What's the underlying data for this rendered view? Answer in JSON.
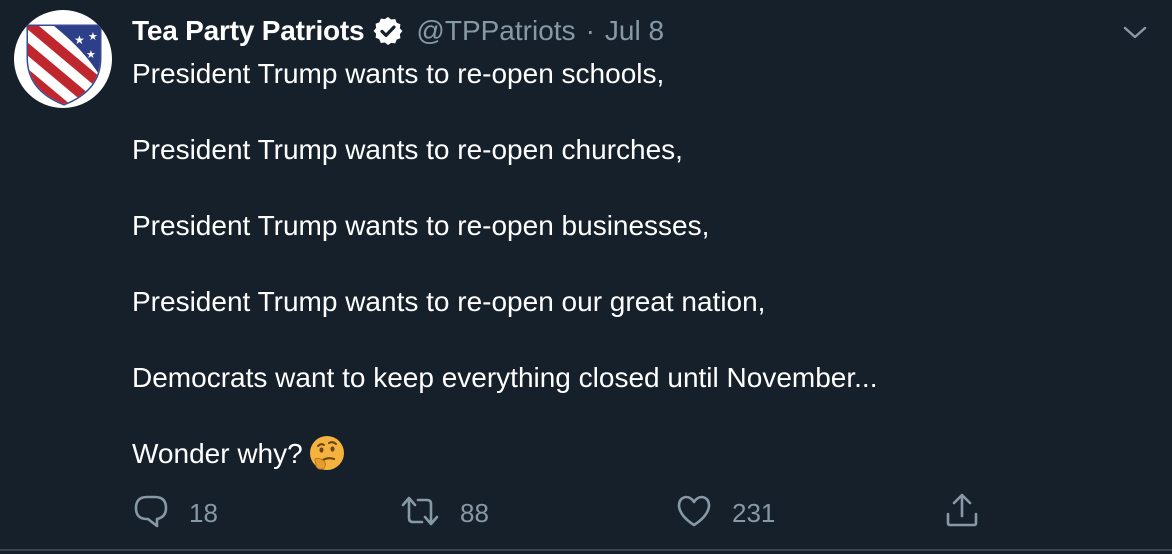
{
  "tweet": {
    "display_name": "Tea Party Patriots",
    "handle": "@TPPatriots",
    "separator": "·",
    "date": "Jul 8",
    "lines": [
      "President Trump wants to re-open schools,",
      "President Trump wants to re-open churches,",
      "President Trump wants to re-open businesses,",
      "President Trump wants to re-open our great nation,",
      "Democrats want to keep everything closed until November...",
      "Wonder why?"
    ],
    "emoji": "thinking-face-icon",
    "replies": "18",
    "retweets": "88",
    "likes": "231"
  },
  "colors": {
    "background": "#15202b",
    "text": "#ffffff",
    "muted": "#8899a6",
    "border": "#38444d"
  },
  "icons": [
    "shield-flag-avatar",
    "verified-badge-icon",
    "chevron-down-icon",
    "reply-icon",
    "retweet-icon",
    "like-icon",
    "share-icon",
    "thinking-face-icon"
  ]
}
